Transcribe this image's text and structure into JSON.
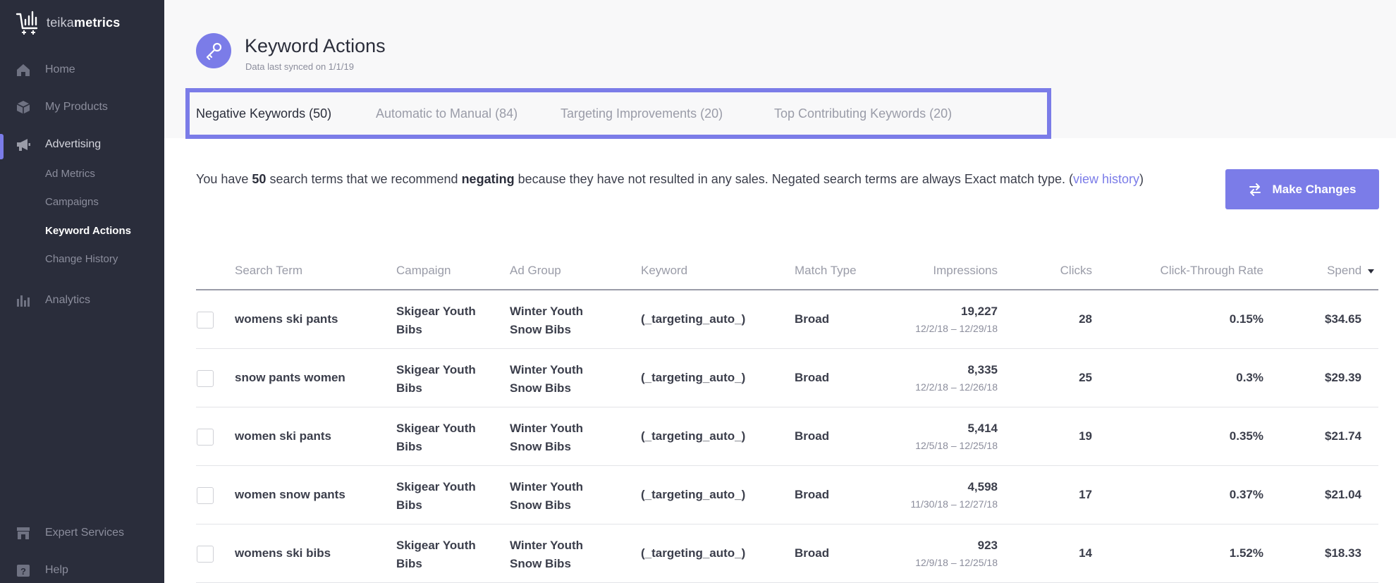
{
  "app": {
    "logo_light": "teika",
    "logo_bold": "metrics"
  },
  "sidebar": {
    "items": [
      {
        "label": "Home",
        "icon": "home-icon"
      },
      {
        "label": "My Products",
        "icon": "box-icon"
      },
      {
        "label": "Advertising",
        "icon": "megaphone-icon"
      },
      {
        "label": "Analytics",
        "icon": "bar-chart-icon"
      }
    ],
    "sub_items": [
      "Ad Metrics",
      "Campaigns",
      "Keyword Actions",
      "Change History"
    ],
    "bottom_items": [
      {
        "label": "Expert Services",
        "icon": "storefront-icon"
      },
      {
        "label": "Help",
        "icon": "help-icon"
      }
    ],
    "accent": "#7b7ce8"
  },
  "header": {
    "title": "Keyword Actions",
    "subtitle": "Data last synced on 1/1/19",
    "icon": "key-icon"
  },
  "tabs": [
    "Negative Keywords (50)",
    "Automatic to Manual (84)",
    "Targeting Improvements (20)",
    "Top Contributing Keywords (20)"
  ],
  "description": {
    "p1": "You have ",
    "count": "50",
    "p2": " search terms that we recommend ",
    "action": "negating",
    "p3": " because they have not resulted in any sales. Negated search terms are always Exact match type. (",
    "link": "view history",
    "p4": ")"
  },
  "make_changes": {
    "label": "Make Changes",
    "icon": "swap-arrows-icon"
  },
  "table": {
    "headers": [
      "Search Term",
      "Campaign",
      "Ad Group",
      "Keyword",
      "Match Type",
      "Impressions",
      "Clicks",
      "Click-Through Rate",
      "Spend"
    ],
    "sort_icon": "caret-down-icon",
    "rows": [
      {
        "term": "womens ski pants",
        "campaign": "Skigear Youth Bibs",
        "adgroup": "Winter Youth Snow Bibs",
        "keyword": "(_targeting_auto_)",
        "match": "Broad",
        "impressions": "19,227",
        "dates": "12/2/18 – 12/29/18",
        "clicks": "28",
        "ctr": "0.15%",
        "spend": "$34.65"
      },
      {
        "term": "snow pants women",
        "campaign": "Skigear Youth Bibs",
        "adgroup": "Winter Youth Snow Bibs",
        "keyword": "(_targeting_auto_)",
        "match": "Broad",
        "impressions": "8,335",
        "dates": "12/2/18 – 12/26/18",
        "clicks": "25",
        "ctr": "0.3%",
        "spend": "$29.39"
      },
      {
        "term": "women ski pants",
        "campaign": "Skigear Youth Bibs",
        "adgroup": "Winter Youth Snow Bibs",
        "keyword": "(_targeting_auto_)",
        "match": "Broad",
        "impressions": "5,414",
        "dates": "12/5/18 – 12/25/18",
        "clicks": "19",
        "ctr": "0.35%",
        "spend": "$21.74"
      },
      {
        "term": "women snow pants",
        "campaign": "Skigear Youth Bibs",
        "adgroup": "Winter Youth Snow Bibs",
        "keyword": "(_targeting_auto_)",
        "match": "Broad",
        "impressions": "4,598",
        "dates": "11/30/18 – 12/27/18",
        "clicks": "17",
        "ctr": "0.37%",
        "spend": "$21.04"
      },
      {
        "term": "womens ski bibs",
        "campaign": "Skigear Youth Bibs",
        "adgroup": "Winter Youth Snow Bibs",
        "keyword": "(_targeting_auto_)",
        "match": "Broad",
        "impressions": "923",
        "dates": "12/9/18 – 12/25/18",
        "clicks": "14",
        "ctr": "1.52%",
        "spend": "$18.33"
      }
    ]
  }
}
